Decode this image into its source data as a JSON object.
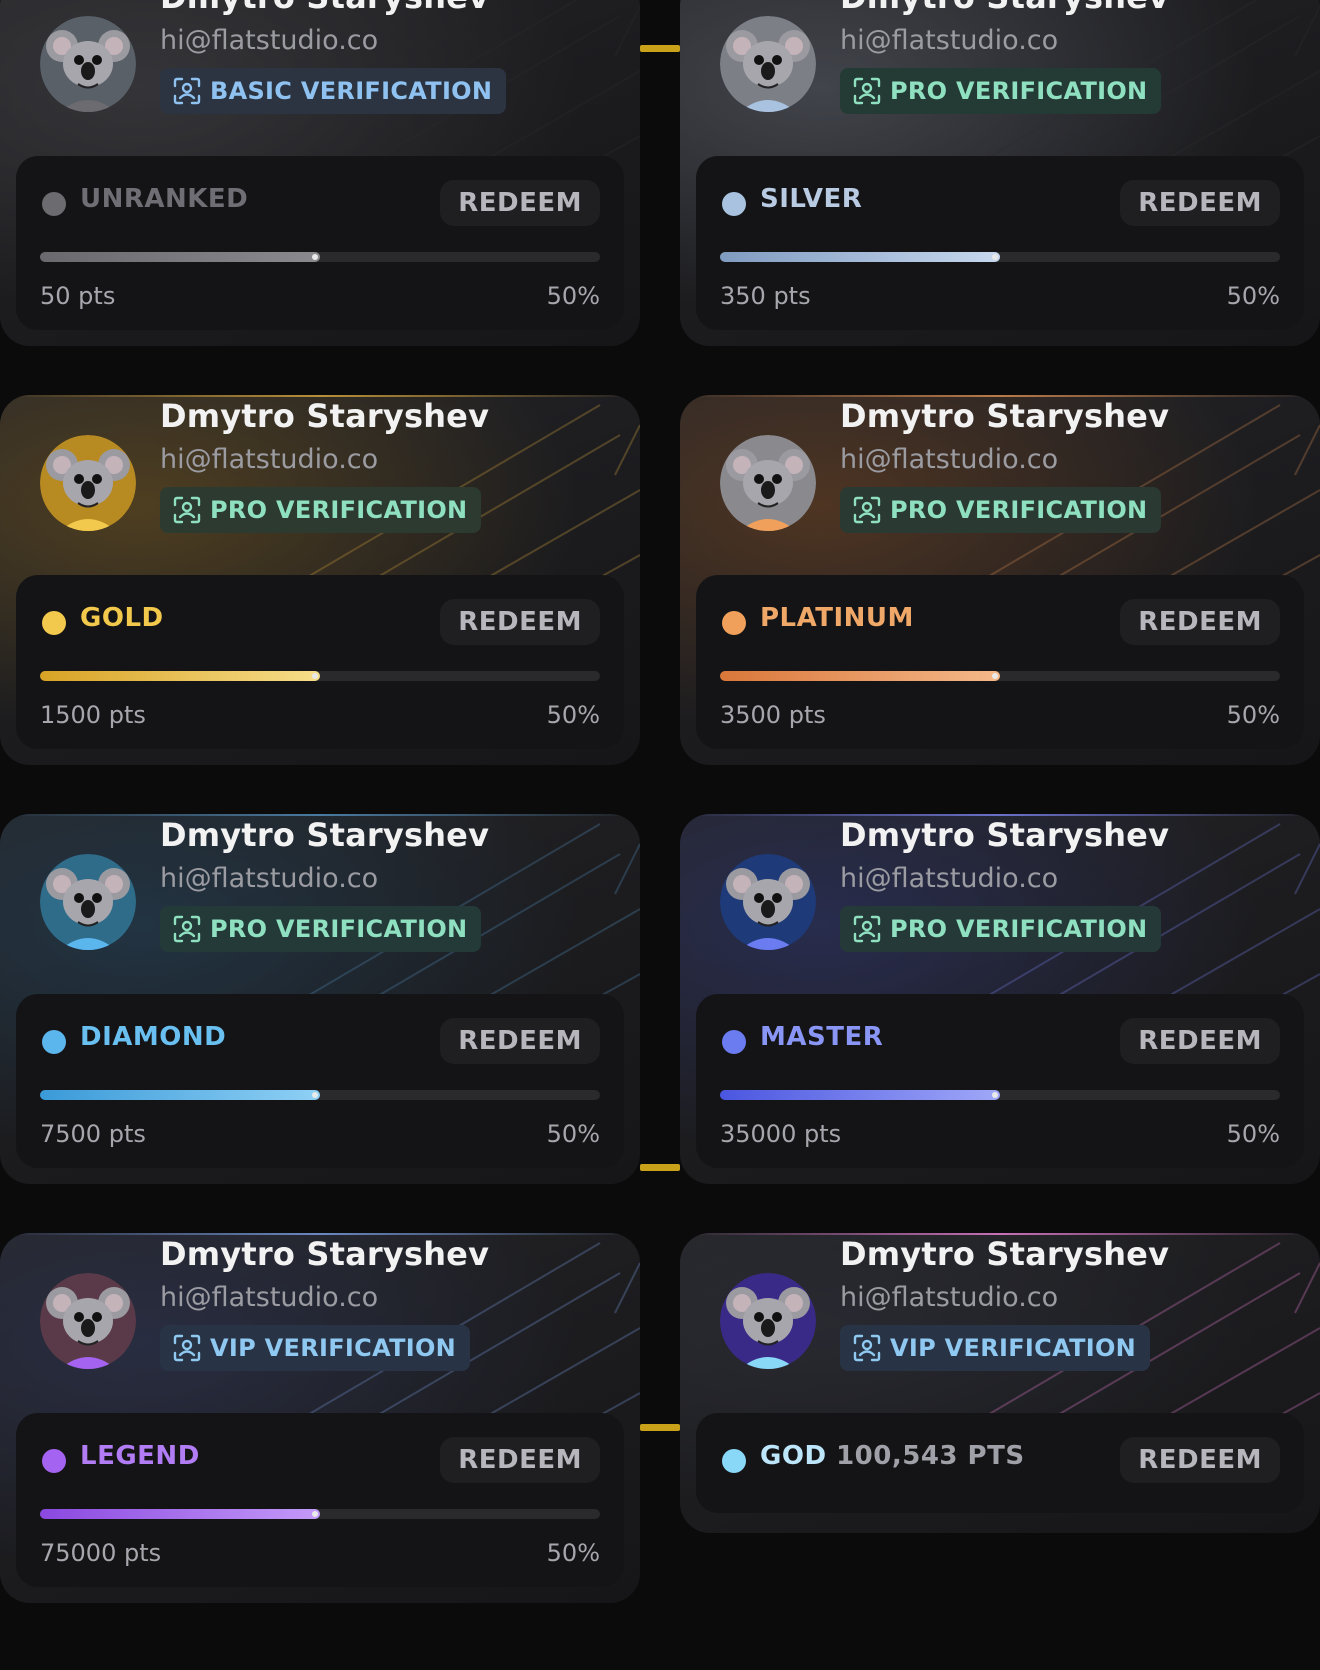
{
  "cards": [
    {
      "name": "Dmytro Staryshev",
      "email": "hi@flatstudio.co",
      "verification": "BASIC VERIFICATION",
      "tier": "UNRANKED",
      "tier_extra": "",
      "redeem": "REDEEM",
      "points": "50 pts",
      "percent": "50%",
      "progress": 0.5,
      "colors": {
        "tier": "#6b6b70",
        "tier_text": "#6e6e74",
        "fill_from": "#6a6a6e",
        "fill_to": "#8a8a8e",
        "badge_bg": "#2b3440",
        "badge_text": "#8fc2f0",
        "glow": "#3a3a3e",
        "topline": "#2a2a2d",
        "avatar": "#5a6068"
      }
    },
    {
      "name": "Dmytro Staryshev",
      "email": "hi@flatstudio.co",
      "verification": "PRO VERIFICATION",
      "tier": "SILVER",
      "tier_extra": "",
      "redeem": "REDEEM",
      "points": "350 pts",
      "percent": "50%",
      "progress": 0.5,
      "colors": {
        "tier": "#a9c2e0",
        "tier_text": "#b8cbe3",
        "fill_from": "#7f9bc0",
        "fill_to": "#c7d8ee",
        "badge_bg": "#243a34",
        "badge_text": "#8fe0c0",
        "glow": "#4a4d55",
        "topline": "#2c2c30",
        "avatar": "#7c7f86"
      }
    },
    {
      "name": "Dmytro Staryshev",
      "email": "hi@flatstudio.co",
      "verification": "PRO VERIFICATION",
      "tier": "GOLD",
      "tier_extra": "",
      "redeem": "REDEEM",
      "points": "1500 pts",
      "percent": "50%",
      "progress": 0.5,
      "colors": {
        "tier": "#f2c94c",
        "tier_text": "#f2c94c",
        "fill_from": "#d8a325",
        "fill_to": "#f7de8a",
        "badge_bg": "#2c3a30",
        "badge_text": "#8fe0c0",
        "glow": "#5a4620",
        "topline": "#b88f3a",
        "avatar": "#b88a22"
      }
    },
    {
      "name": "Dmytro Staryshev",
      "email": "hi@flatstudio.co",
      "verification": "PRO VERIFICATION",
      "tier": "PLATINUM",
      "tier_extra": "",
      "redeem": "REDEEM",
      "points": "3500 pts",
      "percent": "50%",
      "progress": 0.5,
      "colors": {
        "tier": "#f0a05a",
        "tier_text": "#f0a868",
        "fill_from": "#d9773a",
        "fill_to": "#f5b98a",
        "badge_bg": "#2a3a32",
        "badge_text": "#8fe0c0",
        "glow": "#5a3a22",
        "topline": "#b87a4a",
        "avatar": "#8a8a8e"
      }
    },
    {
      "name": "Dmytro Staryshev",
      "email": "hi@flatstudio.co",
      "verification": "PRO VERIFICATION",
      "tier": "DIAMOND",
      "tier_extra": "",
      "redeem": "REDEEM",
      "points": "7500 pts",
      "percent": "50%",
      "progress": 0.5,
      "colors": {
        "tier": "#5bb6ee",
        "tier_text": "#68bff0",
        "fill_from": "#3a9ad8",
        "fill_to": "#8fd0f5",
        "badge_bg": "#233a38",
        "badge_text": "#8fe0c0",
        "glow": "#22384a",
        "topline": "#4a7aa0",
        "avatar": "#2e6c8a"
      }
    },
    {
      "name": "Dmytro Staryshev",
      "email": "hi@flatstudio.co",
      "verification": "PRO VERIFICATION",
      "tier": "MASTER",
      "tier_extra": "",
      "redeem": "REDEEM",
      "points": "35000 pts",
      "percent": "50%",
      "progress": 0.5,
      "colors": {
        "tier": "#6a7cf0",
        "tier_text": "#8a96f5",
        "fill_from": "#4a56e0",
        "fill_to": "#a0a8f8",
        "badge_bg": "#253a38",
        "badge_text": "#8fe0c0",
        "glow": "#2a2f58",
        "topline": "#6a70c8",
        "avatar": "#1e3a78"
      }
    },
    {
      "name": "Dmytro Staryshev",
      "email": "hi@flatstudio.co",
      "verification": "VIP VERIFICATION",
      "tier": "LEGEND",
      "tier_extra": "",
      "redeem": "REDEEM",
      "points": "75000 pts",
      "percent": "50%",
      "progress": 0.5,
      "colors": {
        "tier": "#a463f0",
        "tier_text": "#b27cf5",
        "fill_from": "#8a48e0",
        "fill_to": "#c49af8",
        "badge_bg": "#283446",
        "badge_text": "#8fc8f0",
        "glow": "#2a3048",
        "topline": "#6a88c0",
        "avatar": "#5a3a48"
      }
    },
    {
      "name": "Dmytro Staryshev",
      "email": "hi@flatstudio.co",
      "verification": "VIP VERIFICATION",
      "tier": "GOD",
      "tier_extra": "100,543 PTS",
      "redeem": "REDEEM",
      "points": "",
      "percent": "",
      "progress": null,
      "colors": {
        "tier": "#8ad8f8",
        "tier_text": "#bde6fb",
        "fill_from": "#8ad8f8",
        "fill_to": "#d0a0f0",
        "badge_bg": "#283446",
        "badge_text": "#8fc8f0",
        "glow": "#2a2c34",
        "topline": "#c870b8",
        "avatar": "#3a2a88"
      }
    }
  ]
}
